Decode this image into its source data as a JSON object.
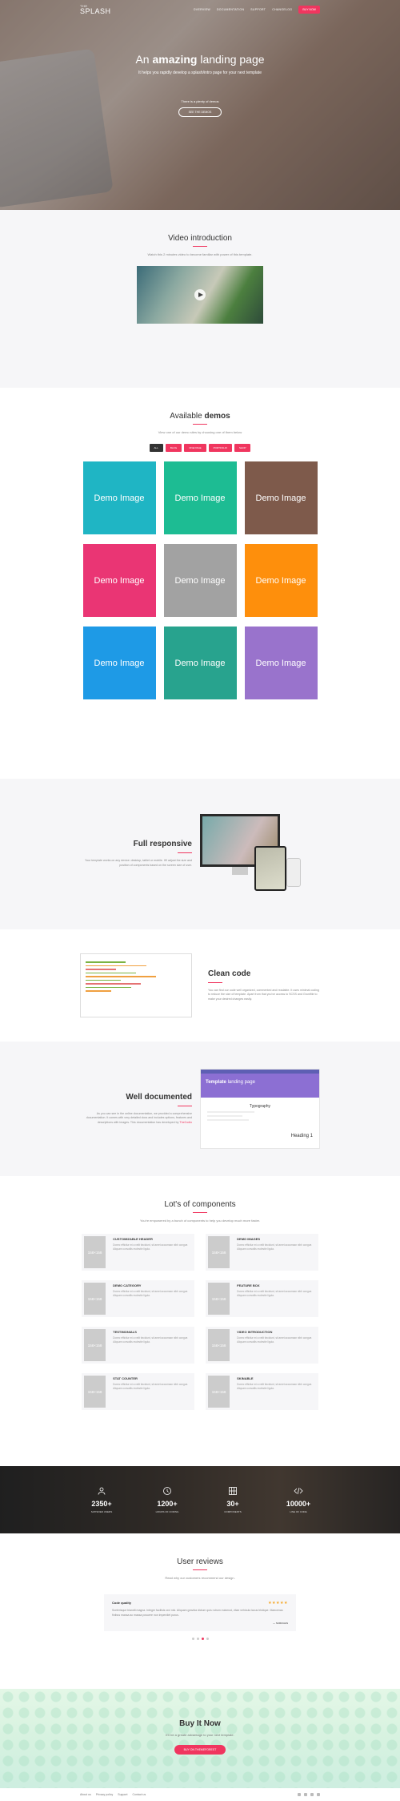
{
  "nav": {
    "logo_top": "THE",
    "logo_main": "SPLASH",
    "links": [
      "OVERVIEW",
      "DOCUMENTATION",
      "SUPPORT",
      "CHANGELOG"
    ],
    "cta": "BUY NOW"
  },
  "hero": {
    "title_pre": "An",
    "title_bold": "amazing",
    "title_post": "landing page",
    "subtitle": "It helps you rapidly develop a splash/intro page for your next template",
    "small": "There is a plenty of demos",
    "button": "SEE THE DEMOS"
  },
  "video": {
    "title": "Video introduction",
    "lead": "Watch this 2 minutes video to become familiar with power of this template."
  },
  "demos": {
    "title_pre": "Available",
    "title_bold": "demos",
    "lead": "View one of our demo sites by choosing one of them below",
    "filters": [
      "ALL",
      "BLOG",
      "ONE PAGE",
      "PORTFOLIO",
      "SHOP"
    ],
    "item_label": "Demo Image",
    "colors": [
      "#1fb5c4",
      "#1dbc93",
      "#7e5a4b",
      "#ea3574",
      "#a2a2a2",
      "#fe8f0c",
      "#1e9ae6",
      "#28a38e",
      "#9973cc"
    ]
  },
  "responsive": {
    "title_pre": "Full",
    "title_post": "responsive",
    "body": "Your template works on any device: desktop, tablet or mobile. It'll adjust the size and position of components based on the screen size of user."
  },
  "clean": {
    "title": "Clean code",
    "body": "You can find our code well organized, commented and readable. It uses minimal coding to reduce the size of template. Apart from that you've access to SCSS and Gruntfile to make your desired changes easily."
  },
  "documented": {
    "title_pre": "Well",
    "title_post": "documented",
    "body_main": "As you can see in the online documentation, we provided a comprehensive documentation. It comes with very detailed docs and includes options, features and descriptions with images. This documentation has developed by",
    "body_link": "TheCodio",
    "docs_head_bold": "Template",
    "docs_head_rest": "landing page",
    "docs_typo": "Typography",
    "docs_heading": "Heading 1"
  },
  "components": {
    "title": "Lot's of components",
    "lead": "You're empowered by a bunch of components to help you develop much more faster.",
    "thumb_label": "158×158",
    "items": [
      {
        "title": "CUSTOMIZABLE HEADER",
        "desc": "Donec efficitur mi a velit tincidunt, sit amet accumsan nibh congue. Aliquam convallis molestie ligula."
      },
      {
        "title": "DEMO IMAGES",
        "desc": "Donec efficitur mi a velit tincidunt, sit amet accumsan nibh congue. Aliquam convallis molestie ligula."
      },
      {
        "title": "DEMO CATEGORY",
        "desc": "Donec efficitur mi a velit tincidunt, sit amet accumsan nibh congue. Aliquam convallis molestie ligula."
      },
      {
        "title": "FEATURE BOX",
        "desc": "Donec efficitur mi a velit tincidunt, sit amet accumsan nibh congue. Aliquam convallis molestie ligula."
      },
      {
        "title": "TESTIMONIALS",
        "desc": "Donec efficitur mi a velit tincidunt, sit amet accumsan nibh congue. Aliquam convallis molestie ligula."
      },
      {
        "title": "VIDEO INTRODUCTION",
        "desc": "Donec efficitur mi a velit tincidunt, sit amet accumsan nibh congue. Aliquam convallis molestie ligula."
      },
      {
        "title": "STAT COUNTER",
        "desc": "Donec efficitur mi a velit tincidunt, sit amet accumsan nibh congue. Aliquam convallis molestie ligula."
      },
      {
        "title": "SKINABLE",
        "desc": "Donec efficitur mi a velit tincidunt, sit amet accumsan nibh congue. Aliquam convallis molestie ligula."
      }
    ]
  },
  "counters": [
    {
      "icon": "user-icon",
      "num": "2350+",
      "label": "SATISFIED USERS"
    },
    {
      "icon": "clock-icon",
      "num": "1200+",
      "label": "HOURS OF CODING"
    },
    {
      "icon": "grid-icon",
      "num": "30+",
      "label": "COMPONENTS"
    },
    {
      "icon": "code-icon",
      "num": "10000+",
      "label": "LINE OF CODE"
    }
  ],
  "reviews": {
    "title": "User reviews",
    "lead": "Read why our customers recommend our design.",
    "name": "Code quality",
    "stars": "★★★★★",
    "quote": "Scelerisque blandit magna. Integer facilisis orci nisi. Aliquam gravida dictum quis rutrum euismod, vitae vehicula lacus tristique. Maecenas finibus massa ac massa posuere non imperdiet purus.",
    "author": "— SCRUGGS"
  },
  "buy": {
    "title_bold": "Buy",
    "title_rest": "It Now",
    "subtitle": "It'll be a greate advantage to your next template.",
    "button": "BUY ON THEMEFOREST"
  },
  "footer": {
    "links": [
      "About us",
      "Privacy policy",
      "Support",
      "Contact us"
    ]
  }
}
